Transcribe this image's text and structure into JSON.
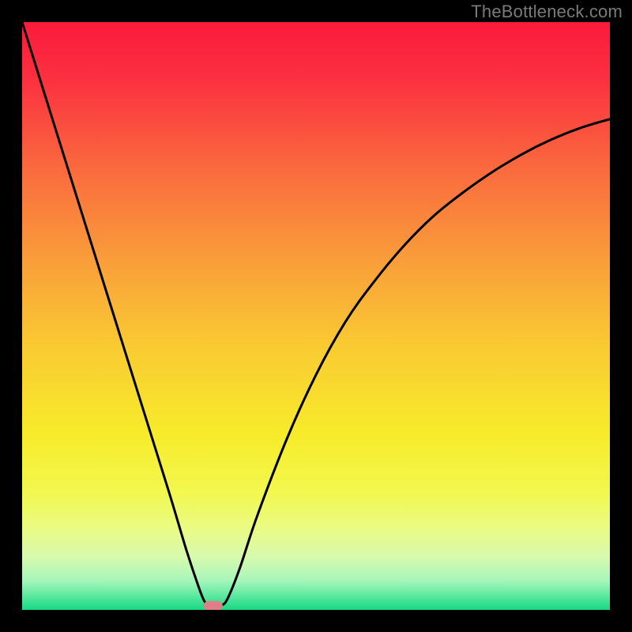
{
  "watermark": "TheBottleneck.com",
  "chart_data": {
    "type": "line",
    "title": "",
    "xlabel": "",
    "ylabel": "",
    "xlim": [
      0,
      100
    ],
    "ylim": [
      0,
      100
    ],
    "axes_visible": false,
    "grid": false,
    "background": "gradient-red-yellow-green",
    "series": [
      {
        "name": "bottleneck-curve",
        "x": [
          0,
          5,
          10,
          15,
          20,
          25,
          28,
          30,
          31,
          32,
          33,
          34,
          35,
          37,
          40,
          45,
          50,
          55,
          60,
          65,
          70,
          75,
          80,
          85,
          90,
          95,
          100
        ],
        "y": [
          100,
          84,
          68,
          52,
          36,
          20,
          10,
          4,
          1.5,
          0.5,
          0.5,
          0.8,
          2,
          7,
          16,
          29,
          40,
          49,
          56,
          62,
          67,
          71,
          74.5,
          77.5,
          80,
          82,
          83.5
        ]
      }
    ],
    "marker": {
      "name": "optimal-point",
      "x": 32.5,
      "y": 0.7,
      "color": "#dd7f87",
      "shape": "rounded-rect"
    },
    "frame": {
      "color": "#000000",
      "thickness_px": 28
    },
    "gradient_stops": [
      {
        "pos": 0.0,
        "color": "#fb1a3c"
      },
      {
        "pos": 0.1,
        "color": "#fb3140"
      },
      {
        "pos": 0.25,
        "color": "#fa6a3e"
      },
      {
        "pos": 0.4,
        "color": "#f99c3a"
      },
      {
        "pos": 0.55,
        "color": "#f9ca32"
      },
      {
        "pos": 0.7,
        "color": "#f7eb2a"
      },
      {
        "pos": 0.8,
        "color": "#f2f84e"
      },
      {
        "pos": 0.86,
        "color": "#eafb82"
      },
      {
        "pos": 0.91,
        "color": "#d7faae"
      },
      {
        "pos": 0.95,
        "color": "#a8f6bb"
      },
      {
        "pos": 0.975,
        "color": "#5fe9a1"
      },
      {
        "pos": 1.0,
        "color": "#16d983"
      }
    ]
  }
}
